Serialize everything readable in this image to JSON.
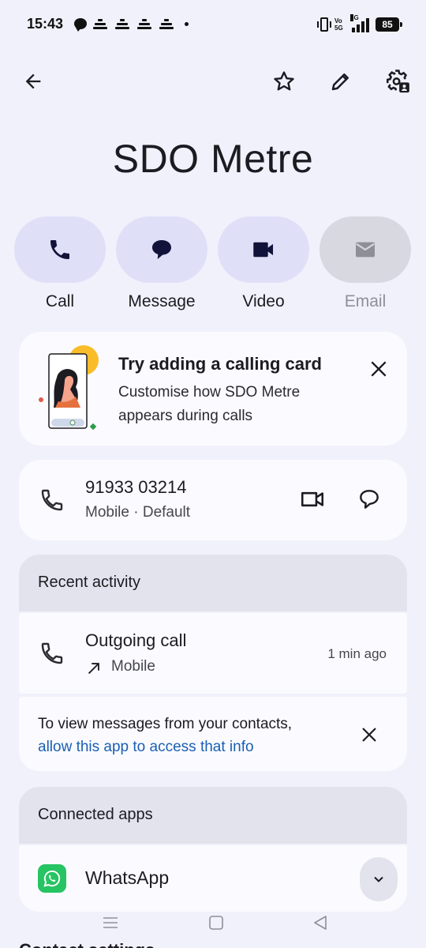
{
  "status_bar": {
    "time": "15:43",
    "network": "5G",
    "volte": "Vo 5G",
    "battery": "85"
  },
  "toolbar": {
    "back_icon": "arrow-left-icon",
    "favorite_icon": "star-outline-icon",
    "edit_icon": "pencil-icon",
    "settings_icon": "gear-person-icon"
  },
  "contact": {
    "name": "SDO Metre"
  },
  "actions": [
    {
      "label": "Call",
      "icon": "phone-icon",
      "enabled": true
    },
    {
      "label": "Message",
      "icon": "message-bubble-icon",
      "enabled": true
    },
    {
      "label": "Video",
      "icon": "video-camera-icon",
      "enabled": true
    },
    {
      "label": "Email",
      "icon": "envelope-icon",
      "enabled": false
    }
  ],
  "calling_card": {
    "title": "Try adding a calling card",
    "subtitle": "Customise how SDO Metre appears during calls"
  },
  "phone": {
    "number": "91933 03214",
    "type": "Mobile · Default"
  },
  "recent_activity": {
    "header": "Recent activity",
    "entry_title": "Outgoing call",
    "entry_sub": "Mobile",
    "entry_time": "1 min ago"
  },
  "messages_prompt": {
    "text": "To view messages from your contacts,",
    "link": "allow this app to access that info"
  },
  "connected_apps": {
    "header": "Connected apps",
    "app_name": "WhatsApp"
  },
  "contact_settings": {
    "header": "Contact settings"
  },
  "colors": {
    "background": "#f1f1fb",
    "action_pill": "#dfdff8",
    "link": "#1a5fb4",
    "whatsapp": "#26c463"
  }
}
